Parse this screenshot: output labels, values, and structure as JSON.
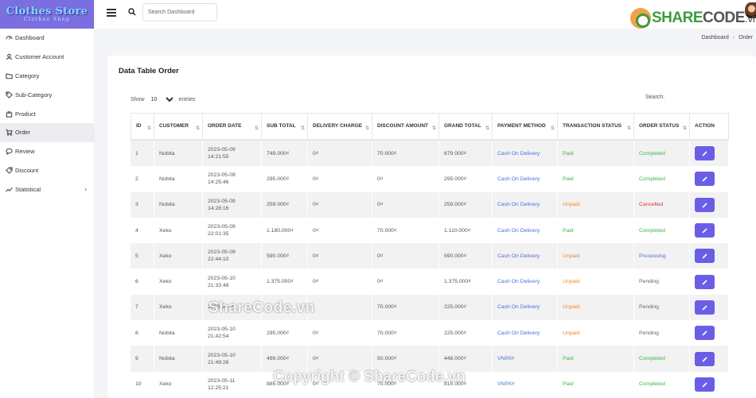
{
  "brand": {
    "title": "Clothes Store",
    "subtitle": "Clothes Shop"
  },
  "sidebar": {
    "items": [
      {
        "label": "Dashboard",
        "icon": "dashboard-icon"
      },
      {
        "label": "Customer Account",
        "icon": "user-icon"
      },
      {
        "label": "Category",
        "icon": "folder-icon"
      },
      {
        "label": "Sub-Category",
        "icon": "tag-icon"
      },
      {
        "label": "Product",
        "icon": "bag-icon"
      },
      {
        "label": "Order",
        "icon": "cart-icon"
      },
      {
        "label": "Review",
        "icon": "comment-icon"
      },
      {
        "label": "Discount",
        "icon": "price-tag-icon"
      },
      {
        "label": "Statistical",
        "icon": "chart-line-icon"
      }
    ],
    "active": "Order"
  },
  "header": {
    "search_placeholder": "Search Dashboard"
  },
  "logo": {
    "part1": "SHARE",
    "part2": "CODE",
    "part3": ".vn"
  },
  "breadcrumb": {
    "home": "Dashboard",
    "current": "Order"
  },
  "card": {
    "title": "Data Table Order",
    "show_label": "Show",
    "entries_value": "10",
    "entries_label": "entries",
    "search_label": "Search:"
  },
  "table": {
    "headers": [
      "ID",
      "CUSTOMER",
      "ORDER DATE",
      "SUB TOTAL",
      "DELIVERY CHARGE",
      "DISCOUNT AMOUNT",
      "GRAND TOTAL",
      "PAYMENT METHOD",
      "TRANSACTION STATUS",
      "ORDER STATUS",
      "ACTION"
    ],
    "rows": [
      {
        "id": "1",
        "customer": "Nobita",
        "date": "2023-05-09",
        "time": "14:21:55",
        "sub_total": "749.000₫",
        "delivery": "0₫",
        "discount": "70.000₫",
        "grand_total": "679.000₫",
        "payment": "Cash On Delivery",
        "transaction": "Paid",
        "order_status": "Completed"
      },
      {
        "id": "2",
        "customer": "Nobita",
        "date": "2023-05-09",
        "time": "14:25:46",
        "sub_total": "295.000₫",
        "delivery": "0₫",
        "discount": "0₫",
        "grand_total": "295.000₫",
        "payment": "Cash On Delivery",
        "transaction": "Paid",
        "order_status": "Completed"
      },
      {
        "id": "3",
        "customer": "Nobita",
        "date": "2023-05-09",
        "time": "14:28:16",
        "sub_total": "259.000₫",
        "delivery": "0₫",
        "discount": "0₫",
        "grand_total": "259.000₫",
        "payment": "Cash On Delivery",
        "transaction": "Unpaid",
        "order_status": "Cancelled"
      },
      {
        "id": "4",
        "customer": "Xeko",
        "date": "2023-05-09",
        "time": "22:01:35",
        "sub_total": "1.180.000₫",
        "delivery": "0₫",
        "discount": "70.000₫",
        "grand_total": "1.110.000₫",
        "payment": "Cash On Delivery",
        "transaction": "Paid",
        "order_status": "Completed"
      },
      {
        "id": "5",
        "customer": "Xeko",
        "date": "2023-05-09",
        "time": "22:44:10",
        "sub_total": "590.000₫",
        "delivery": "0₫",
        "discount": "0₫",
        "grand_total": "590.000₫",
        "payment": "Cash On Delivery",
        "transaction": "Unpaid",
        "order_status": "Processing"
      },
      {
        "id": "6",
        "customer": "Xeko",
        "date": "2023-05-10",
        "time": "21:33:48",
        "sub_total": "1.375.000₫",
        "delivery": "0₫",
        "discount": "0₫",
        "grand_total": "1.375.000₫",
        "payment": "Cash On Delivery",
        "transaction": "Unpaid",
        "order_status": "Pending"
      },
      {
        "id": "7",
        "customer": "Xeko",
        "date": "2023-05-10",
        "time": "",
        "sub_total": "",
        "delivery": "",
        "discount": "70.000₫",
        "grand_total": "225.000₫",
        "payment": "Cash On Delivery",
        "transaction": "Unpaid",
        "order_status": "Pending"
      },
      {
        "id": "8",
        "customer": "Nobita",
        "date": "2023-05-10",
        "time": "21:42:54",
        "sub_total": "295.000₫",
        "delivery": "0₫",
        "discount": "70.000₫",
        "grand_total": "225.000₫",
        "payment": "Cash On Delivery",
        "transaction": "Unpaid",
        "order_status": "Pending"
      },
      {
        "id": "9",
        "customer": "Nobita",
        "date": "2023-05-10",
        "time": "21:49:28",
        "sub_total": "498.000₫",
        "delivery": "0₫",
        "discount": "50.000₫",
        "grand_total": "448.000₫",
        "payment": "VNPAY",
        "transaction": "Paid",
        "order_status": "Completed"
      },
      {
        "id": "10",
        "customer": "Xeko",
        "date": "2023-05-11",
        "time": "12:25:21",
        "sub_total": "885.000₫",
        "delivery": "0₫",
        "discount": "70.000₫",
        "grand_total": "815.000₫",
        "payment": "VNPAY",
        "transaction": "Paid",
        "order_status": "Completed"
      }
    ]
  },
  "watermark": {
    "top": "ShareCode.vn",
    "bottom": "Copyright © ShareCode.vn"
  },
  "colors": {
    "accent": "#7b6ee0",
    "button": "#6a5ee6",
    "paid": "#3cb64a",
    "unpaid": "#ee8a2a",
    "cancelled": "#e0333d",
    "link": "#4b6fd8"
  }
}
